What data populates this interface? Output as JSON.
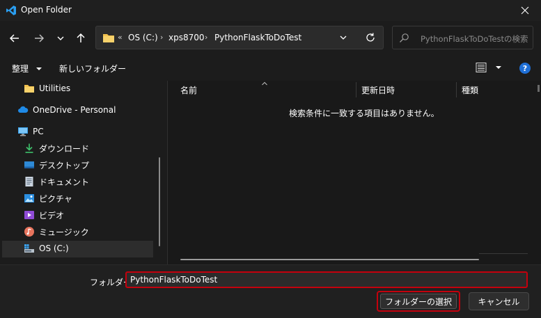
{
  "window": {
    "title": "Open Folder"
  },
  "nav": {
    "back": "back",
    "forward": "forward",
    "recent": "recent",
    "up": "up"
  },
  "address": {
    "overflow": "«",
    "crumbs": [
      "OS (C:)",
      "xps8700",
      "PythonFlaskToDoTest"
    ]
  },
  "search": {
    "placeholder": "PythonFlaskToDoTestの検索"
  },
  "toolbar": {
    "organize": "整理",
    "new_folder": "新しいフォルダー",
    "help": "?"
  },
  "sidebar": {
    "items": [
      {
        "label": "Utilities",
        "icon": "folder-icon"
      },
      {
        "label": "OneDrive - Personal",
        "icon": "cloud-icon"
      },
      {
        "label": "PC",
        "icon": "computer-icon"
      },
      {
        "label": "ダウンロード",
        "icon": "download-icon"
      },
      {
        "label": "デスクトップ",
        "icon": "desktop-icon"
      },
      {
        "label": "ドキュメント",
        "icon": "document-icon"
      },
      {
        "label": "ピクチャ",
        "icon": "pictures-icon"
      },
      {
        "label": "ビデオ",
        "icon": "video-icon"
      },
      {
        "label": "ミュージック",
        "icon": "music-icon"
      },
      {
        "label": "OS (C:)",
        "icon": "drive-icon"
      }
    ],
    "selected": "OS (C:)"
  },
  "list": {
    "columns": [
      "名前",
      "更新日時",
      "種類"
    ],
    "empty_message": "検索条件に一致する項目はありません。"
  },
  "footer": {
    "folder_label": "フォルダー:",
    "folder_value": "PythonFlaskToDoTest",
    "select_button": "フォルダーの選択",
    "cancel_button": "キャンセル"
  },
  "colors": {
    "background": "#1c1c1c",
    "highlight": "#c4000d",
    "accent": "#1f6fd6",
    "folder": "#f2c14e"
  }
}
